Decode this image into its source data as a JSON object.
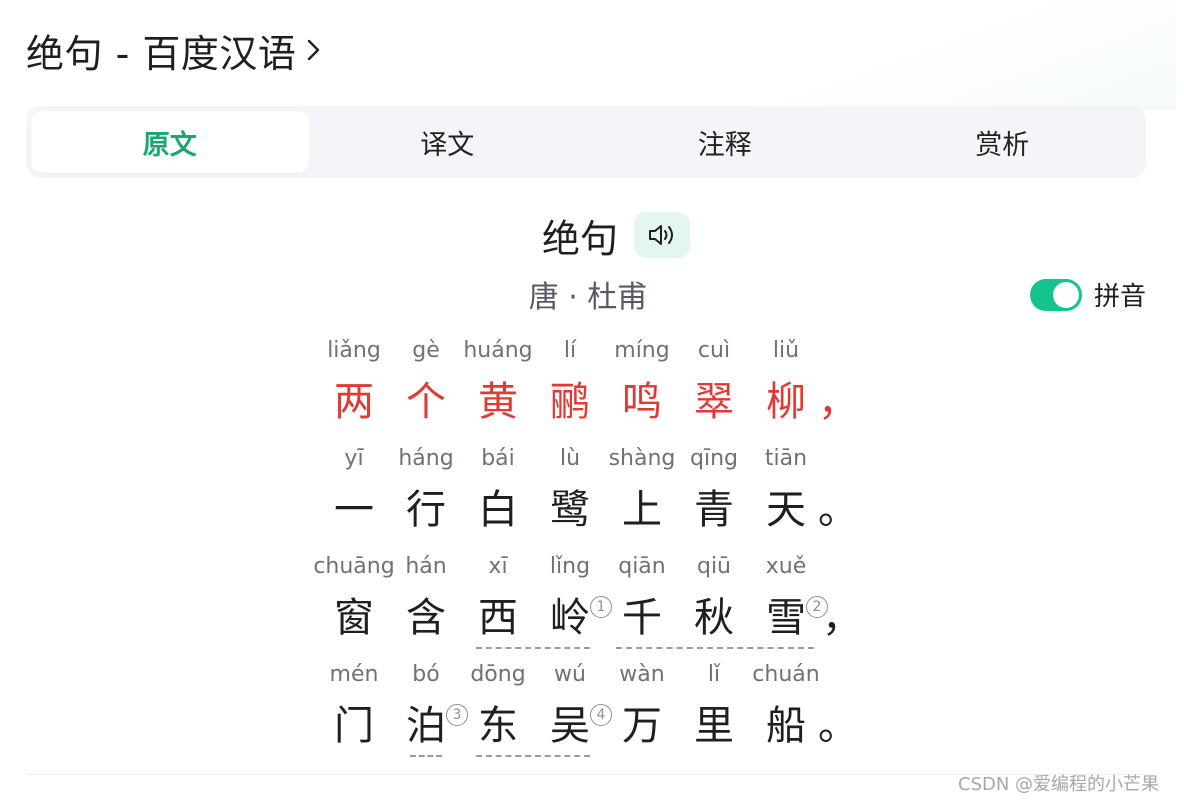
{
  "header": {
    "title": "绝句 - 百度汉语"
  },
  "tabs": [
    {
      "label": "原文",
      "active": true
    },
    {
      "label": "译文",
      "active": false
    },
    {
      "label": "注释",
      "active": false
    },
    {
      "label": "赏析",
      "active": false
    }
  ],
  "poem": {
    "title": "绝句",
    "author": "唐 · 杜甫",
    "lines": [
      {
        "chars": [
          {
            "py": "liǎng",
            "hz": "两"
          },
          {
            "py": "gè",
            "hz": "个"
          },
          {
            "py": "huáng",
            "hz": "黄"
          },
          {
            "py": "lí",
            "hz": "鹂"
          },
          {
            "py": "míng",
            "hz": "鸣"
          },
          {
            "py": "cuì",
            "hz": "翠"
          },
          {
            "py": "liǔ",
            "hz": "柳"
          }
        ],
        "punct": "，"
      },
      {
        "chars": [
          {
            "py": "yī",
            "hz": "一"
          },
          {
            "py": "háng",
            "hz": "行"
          },
          {
            "py": "bái",
            "hz": "白"
          },
          {
            "py": "lù",
            "hz": "鹭"
          },
          {
            "py": "shàng",
            "hz": "上"
          },
          {
            "py": "qīng",
            "hz": "青"
          },
          {
            "py": "tiān",
            "hz": "天"
          }
        ],
        "punct": "。"
      },
      {
        "chars": [
          {
            "py": "chuāng",
            "hz": "窗"
          },
          {
            "py": "hán",
            "hz": "含"
          },
          {
            "py": "xī",
            "hz": "西"
          },
          {
            "py": "lǐng",
            "hz": "岭"
          },
          {
            "py": "qiān",
            "hz": "千"
          },
          {
            "py": "qiū",
            "hz": "秋"
          },
          {
            "py": "xuě",
            "hz": "雪"
          }
        ],
        "punct": "，"
      },
      {
        "chars": [
          {
            "py": "mén",
            "hz": "门"
          },
          {
            "py": "bó",
            "hz": "泊"
          },
          {
            "py": "dōng",
            "hz": "东"
          },
          {
            "py": "wú",
            "hz": "吴"
          },
          {
            "py": "wàn",
            "hz": "万"
          },
          {
            "py": "lǐ",
            "hz": "里"
          },
          {
            "py": "chuán",
            "hz": "船"
          }
        ],
        "punct": "。"
      }
    ],
    "notes": [
      "1",
      "2",
      "3",
      "4"
    ]
  },
  "pinyin_toggle": {
    "label": "拼音",
    "on": true
  },
  "watermark": "CSDN @爱编程的小芒果",
  "colors": {
    "accent": "#1aa774",
    "toggle": "#13c38e",
    "highlight": "#e13a35"
  },
  "icons": {
    "header_chevron": "chevron-right-icon",
    "audio": "speaker-icon"
  }
}
